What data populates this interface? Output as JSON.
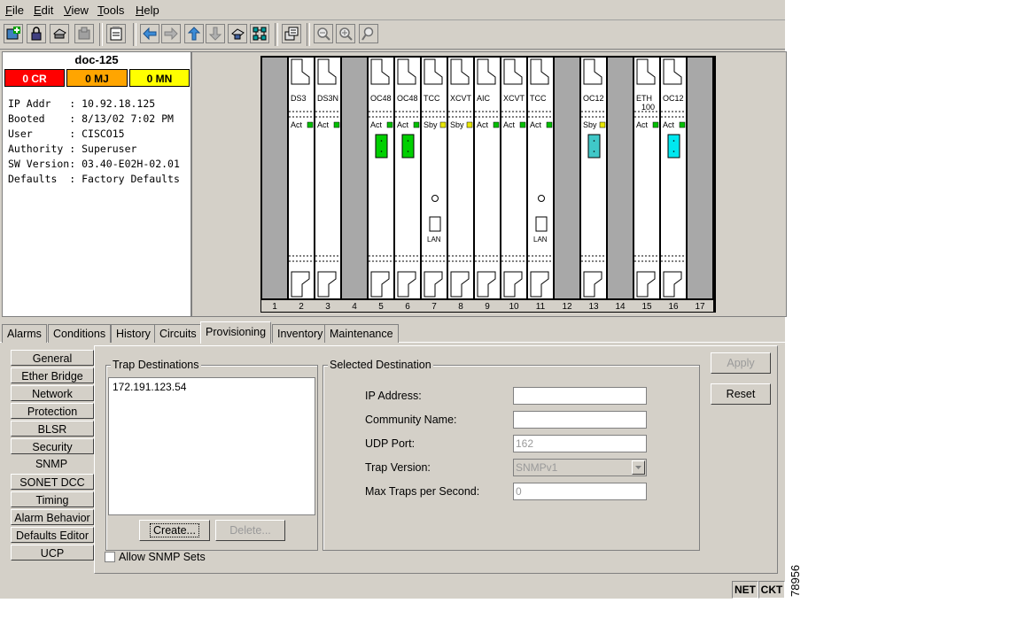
{
  "menubar": {
    "items": [
      {
        "label": "File",
        "key": "F",
        "rest": "ile"
      },
      {
        "label": "Edit",
        "key": "E",
        "rest": "dit"
      },
      {
        "label": "View",
        "key": "V",
        "rest": "iew"
      },
      {
        "label": "Tools",
        "key": "T",
        "rest": "ools"
      },
      {
        "label": "Help",
        "key": "H",
        "rest": "elp"
      }
    ]
  },
  "toolbar": {
    "icons": [
      "add-node-icon",
      "lock-icon",
      "print-icon",
      "export-icon",
      "properties-icon",
      "back-icon",
      "forward-icon",
      "up-icon",
      "down-icon",
      "home-icon",
      "network-view-icon",
      "card-view-icon",
      "zoom-out-icon",
      "zoom-in-icon",
      "zoom-area-icon"
    ]
  },
  "node": {
    "name": "doc-125",
    "alarms": {
      "cr": "0 CR",
      "mj": "0 MJ",
      "mn": "0 MN"
    },
    "info": [
      {
        "label": "IP Addr   ",
        "value": "10.92.18.125"
      },
      {
        "label": "Booted    ",
        "value": "8/13/02 7:02 PM"
      },
      {
        "label": "User      ",
        "value": "CISCO15"
      },
      {
        "label": "Authority ",
        "value": "Superuser"
      },
      {
        "label": "SW Version",
        "value": "03.40-E02H-02.01"
      },
      {
        "label": "Defaults  ",
        "value": "Factory Defaults"
      }
    ]
  },
  "shelf": {
    "slots": [
      {
        "num": "1",
        "card": "",
        "status": "",
        "led": "",
        "port": ""
      },
      {
        "num": "2",
        "card": "DS3",
        "status": "Act",
        "led": "#00c000",
        "port": ""
      },
      {
        "num": "3",
        "card": "DS3N",
        "status": "Act",
        "led": "#00c000",
        "port": ""
      },
      {
        "num": "4",
        "card": "",
        "status": "",
        "led": "",
        "port": ""
      },
      {
        "num": "5",
        "card": "OC48",
        "status": "Act",
        "led": "#00c000",
        "port": "#00d000"
      },
      {
        "num": "6",
        "card": "OC48",
        "status": "Act",
        "led": "#00c000",
        "port": "#00d000"
      },
      {
        "num": "7",
        "card": "TCC",
        "status": "Sby",
        "led": "#e8e800",
        "port": "lan"
      },
      {
        "num": "8",
        "card": "XCVT",
        "status": "Sby",
        "led": "#e8e800",
        "port": ""
      },
      {
        "num": "9",
        "card": "AIC",
        "status": "Act",
        "led": "#00c000",
        "port": ""
      },
      {
        "num": "10",
        "card": "XCVT",
        "status": "Act",
        "led": "#00c000",
        "port": ""
      },
      {
        "num": "11",
        "card": "TCC",
        "status": "Act",
        "led": "#00c000",
        "port": "lan"
      },
      {
        "num": "12",
        "card": "",
        "status": "",
        "led": "",
        "port": ""
      },
      {
        "num": "13",
        "card": "OC12",
        "status": "Sby",
        "led": "#e8e800",
        "port": "#40c8c8"
      },
      {
        "num": "14",
        "card": "",
        "status": "",
        "led": "",
        "port": ""
      },
      {
        "num": "15",
        "card": "ETH",
        "card2": "100",
        "status": "Act",
        "led": "#00c000",
        "port": ""
      },
      {
        "num": "16",
        "card": "OC12",
        "status": "Act",
        "led": "#00c000",
        "port": "#00e8f0"
      },
      {
        "num": "17",
        "card": "",
        "status": "",
        "led": "",
        "port": ""
      }
    ],
    "lan_label": "LAN"
  },
  "tabs": [
    "Alarms",
    "Conditions",
    "History",
    "Circuits",
    "Provisioning",
    "Inventory",
    "Maintenance"
  ],
  "active_tab": "Provisioning",
  "side_buttons": [
    "General",
    "Ether Bridge",
    "Network",
    "Protection",
    "BLSR",
    "Security",
    "SNMP",
    "SONET DCC",
    "Timing",
    "Alarm Behavior",
    "Defaults Editor",
    "UCP"
  ],
  "active_side": "SNMP",
  "snmp": {
    "trap_title": "Trap Destinations",
    "trap_items": [
      "172.191.123.54"
    ],
    "create_label": "Create...",
    "delete_label": "Delete...",
    "allow_label": "Allow SNMP Sets",
    "allow_checked": false,
    "selected_title": "Selected Destination",
    "fields": {
      "ip_label": "IP Address:",
      "ip_value": "",
      "community_label": "Community Name:",
      "community_value": "",
      "udp_label": "UDP Port:",
      "udp_value": "162",
      "version_label": "Trap Version:",
      "version_value": "SNMPv1",
      "max_label": "Max Traps per Second:",
      "max_value": "0"
    },
    "apply_label": "Apply",
    "reset_label": "Reset"
  },
  "statusbar": {
    "net": "NET",
    "ckt": "CKT"
  },
  "figure_number": "78956"
}
